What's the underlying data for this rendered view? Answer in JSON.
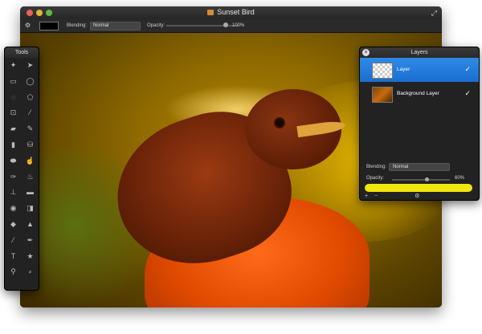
{
  "window": {
    "title": "Sunset Bird",
    "fullscreen_icon": "fullscreen-arrows-icon"
  },
  "toolbar": {
    "gear_icon": "gear-icon",
    "blending_label": "Blending:",
    "blending_value": "Normal",
    "opacity_label": "Opacity:",
    "opacity_value": "100%"
  },
  "tools_panel": {
    "title": "Tools",
    "tools": [
      {
        "name": "magic-wand-icon",
        "glyph": "✦"
      },
      {
        "name": "move-arrow-icon",
        "glyph": "➤"
      },
      {
        "name": "rect-select-icon",
        "glyph": "▭"
      },
      {
        "name": "ellipse-select-icon",
        "glyph": "◯"
      },
      {
        "name": "lasso-icon",
        "glyph": "◌"
      },
      {
        "name": "polygon-lasso-icon",
        "glyph": "⬠"
      },
      {
        "name": "crop-icon",
        "glyph": "⊡"
      },
      {
        "name": "eyedropper-icon",
        "glyph": "⁄"
      },
      {
        "name": "eraser-icon",
        "glyph": "▰"
      },
      {
        "name": "pencil-icon",
        "glyph": "✎"
      },
      {
        "name": "gradient-icon",
        "glyph": "▮"
      },
      {
        "name": "paint-bucket-icon",
        "glyph": "⛁"
      },
      {
        "name": "sponge-icon",
        "glyph": "⬬"
      },
      {
        "name": "smudge-icon",
        "glyph": "☝"
      },
      {
        "name": "brush-icon",
        "glyph": "✑"
      },
      {
        "name": "burn-icon",
        "glyph": "♨"
      },
      {
        "name": "stamp-icon",
        "glyph": "⊥"
      },
      {
        "name": "bandage-icon",
        "glyph": "▬"
      },
      {
        "name": "red-eye-icon",
        "glyph": "◉"
      },
      {
        "name": "dodge-icon",
        "glyph": "◨"
      },
      {
        "name": "drop-icon",
        "glyph": "◆"
      },
      {
        "name": "sharpen-icon",
        "glyph": "▲"
      },
      {
        "name": "line-icon",
        "glyph": "⁄"
      },
      {
        "name": "pen-icon",
        "glyph": "✒"
      },
      {
        "name": "text-icon",
        "glyph": "T"
      },
      {
        "name": "shape-star-icon",
        "glyph": "★"
      },
      {
        "name": "zoom-icon",
        "glyph": "⚲"
      },
      {
        "name": "clone-brush-icon",
        "glyph": "⸗"
      }
    ]
  },
  "layers_panel": {
    "title": "Layers",
    "close_icon": "close-icon",
    "layers": [
      {
        "name": "Layer",
        "visible": true,
        "active": true
      },
      {
        "name": "Background Layer",
        "visible": true,
        "active": false
      }
    ],
    "blending_label": "Blending:",
    "blending_value": "Normal",
    "opacity_label": "Opacity:",
    "opacity_value": "60%",
    "opacity_fraction": 0.6,
    "fill_color": "#f2e611",
    "add_icon": "plus-icon",
    "remove_icon": "minus-icon",
    "settings_icon": "gear-icon"
  },
  "colors": {
    "window_bg": "#1c1c1c",
    "active_layer": "#2f8ae6"
  }
}
